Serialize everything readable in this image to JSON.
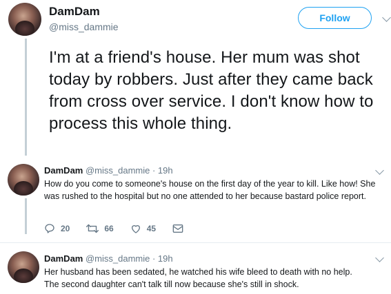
{
  "main_tweet": {
    "author_name": "DamDam",
    "author_handle": "@miss_dammie",
    "follow_label": "Follow",
    "text": "I'm at a friend's house. Her mum was shot today by robbers. Just after they came back from cross over service. I don't know how to process this whole thing."
  },
  "replies": [
    {
      "author_name": "DamDam",
      "meta": "@miss_dammie · 19h",
      "text": "How do you come to someone's house on the first day of the year to kill. Like how! She was rushed to the hospital but no one attended to her because bastard police report.",
      "reply_count": "20",
      "retweet_count": "66",
      "like_count": "45"
    },
    {
      "author_name": "DamDam",
      "meta": "@miss_dammie · 19h",
      "text_line1": "Her husband has been sedated,  he watched his wife bleed to death with no help.",
      "text_line2": "The second daughter can't talk till now because she's still in shock."
    }
  ],
  "colors": {
    "accent": "#1da1f2",
    "muted": "#657786",
    "thread_line": "#c4cfd6"
  }
}
